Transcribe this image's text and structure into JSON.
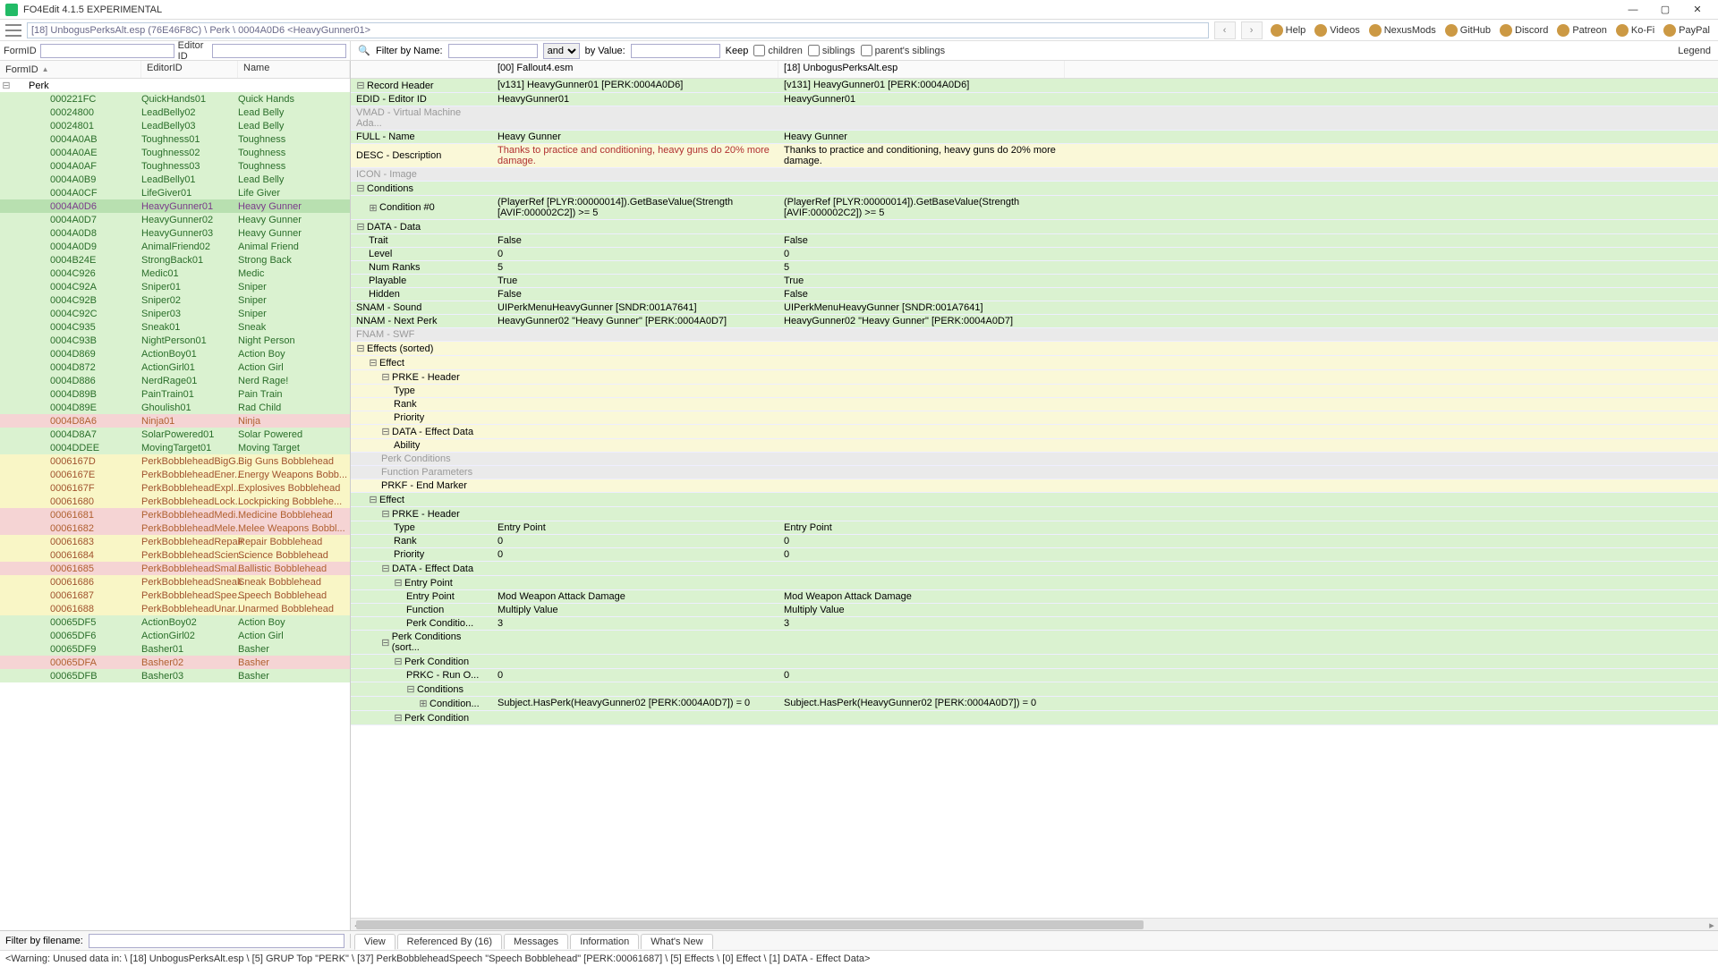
{
  "window": {
    "title": "FO4Edit 4.1.5 EXPERIMENTAL"
  },
  "path": "[18] UnbogusPerksAlt.esp (76E46F8C) \\ Perk \\ 0004A0D6 <HeavyGunner01>",
  "leftFilter": {
    "formIdLabel": "FormID",
    "editorIdLabel": "Editor ID"
  },
  "rightFilter": {
    "filterByName": "Filter by Name:",
    "and": "and",
    "byValue": "by Value:",
    "keep": "Keep",
    "children": "children",
    "siblings": "siblings",
    "parentsSiblings": "parent's siblings",
    "legend": "Legend"
  },
  "topLinks": [
    "Help",
    "Videos",
    "NexusMods",
    "GitHub",
    "Discord",
    "Patreon",
    "Ko-Fi",
    "PayPal"
  ],
  "leftCols": {
    "c1": "FormID",
    "c2": "EditorID",
    "c3": "Name"
  },
  "perkLabel": "Perk",
  "treeRows": [
    {
      "fid": "000221FC",
      "eid": "QuickHands01",
      "name": "Quick Hands",
      "bg": "rg-green",
      "fg": "fg-green"
    },
    {
      "fid": "00024800",
      "eid": "LeadBelly02",
      "name": "Lead Belly",
      "bg": "rg-green",
      "fg": "fg-green"
    },
    {
      "fid": "00024801",
      "eid": "LeadBelly03",
      "name": "Lead Belly",
      "bg": "rg-green",
      "fg": "fg-green"
    },
    {
      "fid": "0004A0AB",
      "eid": "Toughness01",
      "name": "Toughness",
      "bg": "rg-green",
      "fg": "fg-green"
    },
    {
      "fid": "0004A0AE",
      "eid": "Toughness02",
      "name": "Toughness",
      "bg": "rg-green",
      "fg": "fg-green"
    },
    {
      "fid": "0004A0AF",
      "eid": "Toughness03",
      "name": "Toughness",
      "bg": "rg-green",
      "fg": "fg-green"
    },
    {
      "fid": "0004A0B9",
      "eid": "LeadBelly01",
      "name": "Lead Belly",
      "bg": "rg-green",
      "fg": "fg-green"
    },
    {
      "fid": "0004A0CF",
      "eid": "LifeGiver01",
      "name": "Life Giver",
      "bg": "rg-green",
      "fg": "fg-green"
    },
    {
      "fid": "0004A0D6",
      "eid": "HeavyGunner01",
      "name": "Heavy Gunner",
      "bg": "rg-green-sel",
      "fg": "fg-purple",
      "sel": true
    },
    {
      "fid": "0004A0D7",
      "eid": "HeavyGunner02",
      "name": "Heavy Gunner",
      "bg": "rg-green",
      "fg": "fg-green"
    },
    {
      "fid": "0004A0D8",
      "eid": "HeavyGunner03",
      "name": "Heavy Gunner",
      "bg": "rg-green",
      "fg": "fg-green"
    },
    {
      "fid": "0004A0D9",
      "eid": "AnimalFriend02",
      "name": "Animal Friend",
      "bg": "rg-green",
      "fg": "fg-green"
    },
    {
      "fid": "0004B24E",
      "eid": "StrongBack01",
      "name": "Strong Back",
      "bg": "rg-green",
      "fg": "fg-green"
    },
    {
      "fid": "0004C926",
      "eid": "Medic01",
      "name": "Medic",
      "bg": "rg-green",
      "fg": "fg-green"
    },
    {
      "fid": "0004C92A",
      "eid": "Sniper01",
      "name": "Sniper",
      "bg": "rg-green",
      "fg": "fg-green"
    },
    {
      "fid": "0004C92B",
      "eid": "Sniper02",
      "name": "Sniper",
      "bg": "rg-green",
      "fg": "fg-green"
    },
    {
      "fid": "0004C92C",
      "eid": "Sniper03",
      "name": "Sniper",
      "bg": "rg-green",
      "fg": "fg-green"
    },
    {
      "fid": "0004C935",
      "eid": "Sneak01",
      "name": "Sneak",
      "bg": "rg-green",
      "fg": "fg-green"
    },
    {
      "fid": "0004C93B",
      "eid": "NightPerson01",
      "name": "Night Person",
      "bg": "rg-green",
      "fg": "fg-green"
    },
    {
      "fid": "0004D869",
      "eid": "ActionBoy01",
      "name": "Action Boy",
      "bg": "rg-green",
      "fg": "fg-green"
    },
    {
      "fid": "0004D872",
      "eid": "ActionGirl01",
      "name": "Action Girl",
      "bg": "rg-green",
      "fg": "fg-green"
    },
    {
      "fid": "0004D886",
      "eid": "NerdRage01",
      "name": "Nerd Rage!",
      "bg": "rg-green",
      "fg": "fg-green"
    },
    {
      "fid": "0004D89B",
      "eid": "PainTrain01",
      "name": "Pain Train",
      "bg": "rg-green",
      "fg": "fg-green"
    },
    {
      "fid": "0004D89E",
      "eid": "Ghoulish01",
      "name": "Rad Child",
      "bg": "rg-green",
      "fg": "fg-green"
    },
    {
      "fid": "0004D8A6",
      "eid": "Ninja01",
      "name": "Ninja",
      "bg": "rg-pink",
      "fg": "fg-orange"
    },
    {
      "fid": "0004D8A7",
      "eid": "SolarPowered01",
      "name": "Solar Powered",
      "bg": "rg-green",
      "fg": "fg-green"
    },
    {
      "fid": "0004DDEE",
      "eid": "MovingTarget01",
      "name": "Moving Target",
      "bg": "rg-green",
      "fg": "fg-green"
    },
    {
      "fid": "0006167D",
      "eid": "PerkBobbleheadBigG...",
      "name": "Big Guns Bobblehead",
      "bg": "rg-yellow",
      "fg": "fg-dkorange"
    },
    {
      "fid": "0006167E",
      "eid": "PerkBobbleheadEner...",
      "name": "Energy Weapons Bobb...",
      "bg": "rg-yellow",
      "fg": "fg-dkorange"
    },
    {
      "fid": "0006167F",
      "eid": "PerkBobbleheadExpl...",
      "name": "Explosives Bobblehead",
      "bg": "rg-yellow",
      "fg": "fg-dkorange"
    },
    {
      "fid": "00061680",
      "eid": "PerkBobbleheadLock...",
      "name": "Lockpicking Bobblehe...",
      "bg": "rg-yellow",
      "fg": "fg-dkorange"
    },
    {
      "fid": "00061681",
      "eid": "PerkBobbleheadMedi...",
      "name": "Medicine Bobblehead",
      "bg": "rg-pink",
      "fg": "fg-orange"
    },
    {
      "fid": "00061682",
      "eid": "PerkBobbleheadMele...",
      "name": "Melee Weapons Bobbl...",
      "bg": "rg-pink",
      "fg": "fg-orange"
    },
    {
      "fid": "00061683",
      "eid": "PerkBobbleheadRepair",
      "name": "Repair Bobblehead",
      "bg": "rg-yellow",
      "fg": "fg-dkorange"
    },
    {
      "fid": "00061684",
      "eid": "PerkBobbleheadScien...",
      "name": "Science Bobblehead",
      "bg": "rg-yellow",
      "fg": "fg-dkorange"
    },
    {
      "fid": "00061685",
      "eid": "PerkBobbleheadSmal...",
      "name": "Ballistic Bobblehead",
      "bg": "rg-pink",
      "fg": "fg-orange"
    },
    {
      "fid": "00061686",
      "eid": "PerkBobbleheadSneak",
      "name": "Sneak Bobblehead",
      "bg": "rg-yellow",
      "fg": "fg-dkorange"
    },
    {
      "fid": "00061687",
      "eid": "PerkBobbleheadSpee...",
      "name": "Speech Bobblehead",
      "bg": "rg-yellow",
      "fg": "fg-dkorange"
    },
    {
      "fid": "00061688",
      "eid": "PerkBobbleheadUnar...",
      "name": "Unarmed Bobblehead",
      "bg": "rg-yellow",
      "fg": "fg-dkorange"
    },
    {
      "fid": "00065DF5",
      "eid": "ActionBoy02",
      "name": "Action Boy",
      "bg": "rg-green",
      "fg": "fg-green"
    },
    {
      "fid": "00065DF6",
      "eid": "ActionGirl02",
      "name": "Action Girl",
      "bg": "rg-green",
      "fg": "fg-green"
    },
    {
      "fid": "00065DF9",
      "eid": "Basher01",
      "name": "Basher",
      "bg": "rg-green",
      "fg": "fg-green"
    },
    {
      "fid": "00065DFA",
      "eid": "Basher02",
      "name": "Basher",
      "bg": "rg-pink",
      "fg": "fg-orange"
    },
    {
      "fid": "00065DFB",
      "eid": "Basher03",
      "name": "Basher",
      "bg": "rg-green",
      "fg": "fg-green"
    }
  ],
  "gridHeaders": {
    "h2": "[00] Fallout4.esm",
    "h3": "[18] UnbogusPerksAlt.esp"
  },
  "gridRows": [
    {
      "lvl": 0,
      "tw": "-",
      "label": "Record Header",
      "v2": "[v131] HeavyGunner01 [PERK:0004A0D6]",
      "v3": "[v131] HeavyGunner01 [PERK:0004A0D6]",
      "cls": "data-green"
    },
    {
      "lvl": 0,
      "label": "EDID - Editor ID",
      "v2": "HeavyGunner01",
      "v3": "HeavyGunner01",
      "cls": "data-green"
    },
    {
      "lvl": 0,
      "label": "VMAD - Virtual Machine Ada...",
      "cls": "hdr-gray"
    },
    {
      "lvl": 0,
      "label": "FULL - Name",
      "v2": "Heavy Gunner",
      "v3": "Heavy Gunner",
      "cls": "data-green"
    },
    {
      "lvl": 0,
      "label": "DESC - Description",
      "v2": "Thanks to practice and conditioning, heavy guns do 20% more damage.",
      "v3": "Thanks to practice and conditioning, heavy guns do 20% more damage.",
      "cls": "data-yel",
      "v2cls": "red"
    },
    {
      "lvl": 0,
      "label": "ICON - Image",
      "cls": "hdr-gray"
    },
    {
      "lvl": 0,
      "tw": "-",
      "label": "Conditions",
      "cls": "data-green"
    },
    {
      "lvl": 1,
      "tw": "+",
      "label": "Condition #0",
      "v2": "(PlayerRef [PLYR:00000014]).GetBaseValue(Strength [AVIF:000002C2]) >= 5",
      "v3": "(PlayerRef [PLYR:00000014]).GetBaseValue(Strength [AVIF:000002C2]) >= 5",
      "cls": "data-green"
    },
    {
      "lvl": 0,
      "tw": "-",
      "label": "DATA - Data",
      "cls": "data-green"
    },
    {
      "lvl": 1,
      "label": "Trait",
      "v2": "False",
      "v3": "False",
      "cls": "data-green"
    },
    {
      "lvl": 1,
      "label": "Level",
      "v2": "0",
      "v3": "0",
      "cls": "data-green"
    },
    {
      "lvl": 1,
      "label": "Num Ranks",
      "v2": "5",
      "v3": "5",
      "cls": "data-green"
    },
    {
      "lvl": 1,
      "label": "Playable",
      "v2": "True",
      "v3": "True",
      "cls": "data-green"
    },
    {
      "lvl": 1,
      "label": "Hidden",
      "v2": "False",
      "v3": "False",
      "cls": "data-green"
    },
    {
      "lvl": 0,
      "label": "SNAM - Sound",
      "v2": "UIPerkMenuHeavyGunner [SNDR:001A7641]",
      "v3": "UIPerkMenuHeavyGunner [SNDR:001A7641]",
      "cls": "data-green"
    },
    {
      "lvl": 0,
      "label": "NNAM - Next Perk",
      "v2": "HeavyGunner02 \"Heavy Gunner\" [PERK:0004A0D7]",
      "v3": "HeavyGunner02 \"Heavy Gunner\" [PERK:0004A0D7]",
      "cls": "data-green"
    },
    {
      "lvl": 0,
      "label": "FNAM - SWF",
      "cls": "hdr-gray"
    },
    {
      "lvl": 0,
      "tw": "-",
      "label": "Effects (sorted)",
      "cls": "data-yel"
    },
    {
      "lvl": 1,
      "tw": "-",
      "label": "Effect",
      "cls": "data-yel"
    },
    {
      "lvl": 2,
      "tw": "-",
      "label": "PRKE - Header",
      "cls": "data-yel"
    },
    {
      "lvl": 3,
      "label": "Type",
      "cls": "data-yel"
    },
    {
      "lvl": 3,
      "label": "Rank",
      "cls": "data-yel"
    },
    {
      "lvl": 3,
      "label": "Priority",
      "cls": "data-yel"
    },
    {
      "lvl": 2,
      "tw": "-",
      "label": "DATA - Effect Data",
      "cls": "data-yel"
    },
    {
      "lvl": 3,
      "label": "Ability",
      "cls": "data-yel"
    },
    {
      "lvl": 2,
      "label": "Perk Conditions",
      "cls": "hdr-gray"
    },
    {
      "lvl": 2,
      "label": "Function Parameters",
      "cls": "hdr-gray"
    },
    {
      "lvl": 2,
      "label": "PRKF - End Marker",
      "cls": "data-yel"
    },
    {
      "lvl": 1,
      "tw": "-",
      "label": "Effect",
      "cls": "data-green"
    },
    {
      "lvl": 2,
      "tw": "-",
      "label": "PRKE - Header",
      "cls": "data-green"
    },
    {
      "lvl": 3,
      "label": "Type",
      "v2": "Entry Point",
      "v3": "Entry Point",
      "cls": "data-green"
    },
    {
      "lvl": 3,
      "label": "Rank",
      "v2": "0",
      "v3": "0",
      "cls": "data-green"
    },
    {
      "lvl": 3,
      "label": "Priority",
      "v2": "0",
      "v3": "0",
      "cls": "data-green"
    },
    {
      "lvl": 2,
      "tw": "-",
      "label": "DATA - Effect Data",
      "cls": "data-green"
    },
    {
      "lvl": 3,
      "tw": "-",
      "label": "Entry Point",
      "cls": "data-green"
    },
    {
      "lvl": 4,
      "label": "Entry Point",
      "v2": "Mod Weapon Attack Damage",
      "v3": "Mod Weapon Attack Damage",
      "cls": "data-green"
    },
    {
      "lvl": 4,
      "label": "Function",
      "v2": "Multiply Value",
      "v3": "Multiply Value",
      "cls": "data-green"
    },
    {
      "lvl": 4,
      "label": "Perk Conditio...",
      "v2": "3",
      "v3": "3",
      "cls": "data-green"
    },
    {
      "lvl": 2,
      "tw": "-",
      "label": "Perk Conditions (sort...",
      "cls": "data-green"
    },
    {
      "lvl": 3,
      "tw": "-",
      "label": "Perk Condition",
      "cls": "data-green"
    },
    {
      "lvl": 4,
      "label": "PRKC - Run O...",
      "v2": "0",
      "v3": "0",
      "cls": "data-green"
    },
    {
      "lvl": 4,
      "tw": "-",
      "label": "Conditions",
      "cls": "data-green"
    },
    {
      "lvl": 5,
      "tw": "+",
      "label": "Condition...",
      "v2": "Subject.HasPerk(HeavyGunner02 [PERK:0004A0D7]) = 0",
      "v3": "Subject.HasPerk(HeavyGunner02 [PERK:0004A0D7]) = 0",
      "cls": "data-green"
    },
    {
      "lvl": 3,
      "tw": "-",
      "label": "Perk Condition",
      "cls": "data-green"
    }
  ],
  "bottomFilterLabel": "Filter by filename:",
  "tabs": [
    "View",
    "Referenced By (16)",
    "Messages",
    "Information",
    "What's New"
  ],
  "status": "<Warning: Unused data in: \\ [18] UnbogusPerksAlt.esp \\ [5] GRUP Top \"PERK\" \\ [37] PerkBobbleheadSpeech \"Speech Bobblehead\" [PERK:00061687] \\ [5] Effects \\ [0] Effect \\ [1] DATA - Effect Data>"
}
